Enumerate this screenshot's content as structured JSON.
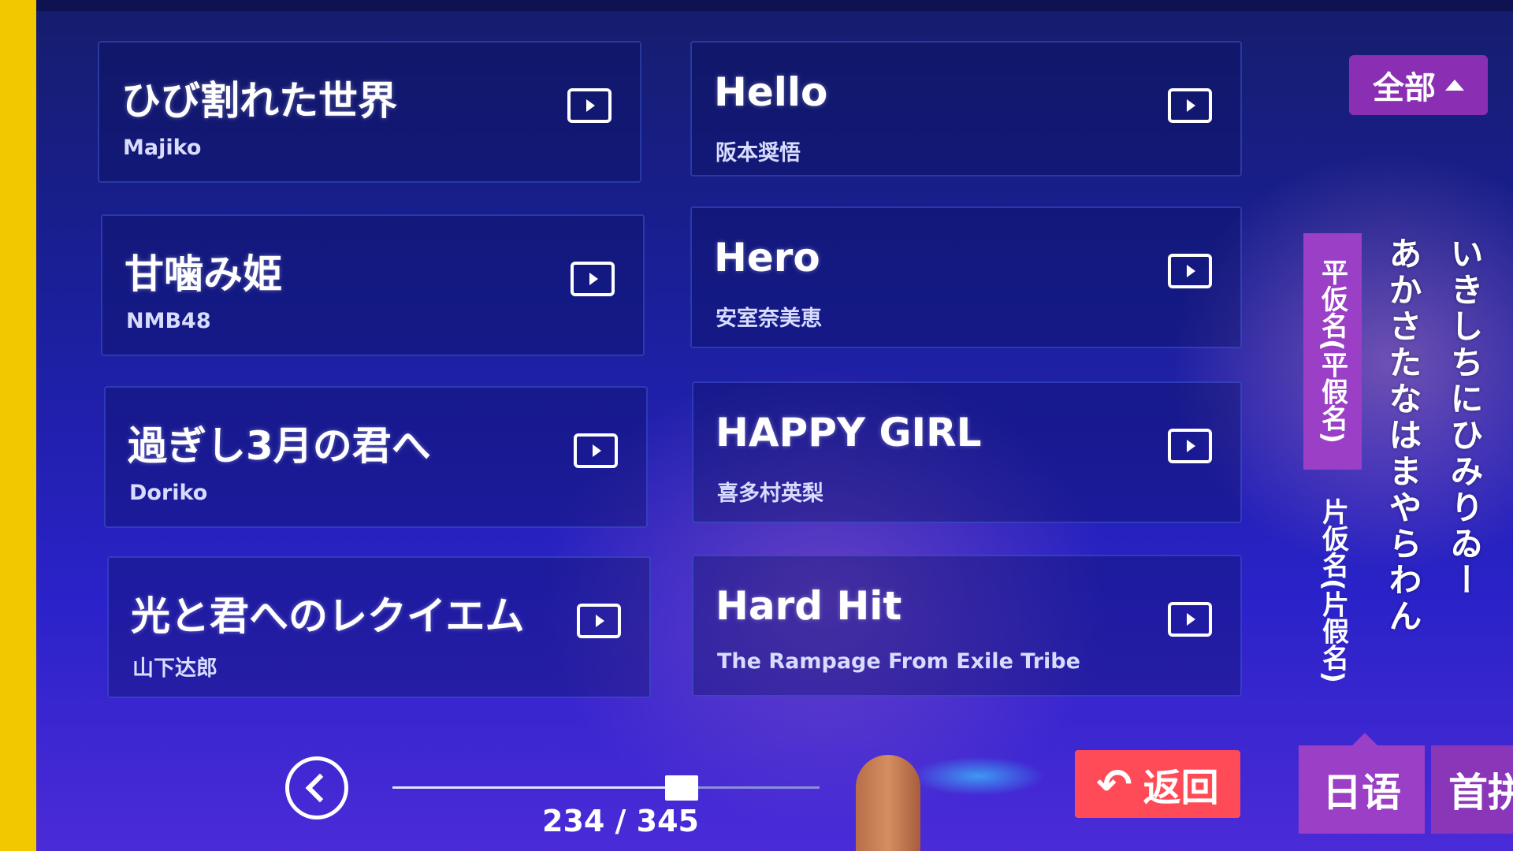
{
  "songs": [
    {
      "title": "ひび割れた世界",
      "artist": "Majiko"
    },
    {
      "title": "Hello",
      "artist": "阪本奨悟"
    },
    {
      "title": "甘噛み姫",
      "artist": "NMB48"
    },
    {
      "title": "Hero",
      "artist": "安室奈美恵"
    },
    {
      "title": "過ぎし3月の君へ",
      "artist": "Doriko"
    },
    {
      "title": "HAPPY GIRL",
      "artist": "喜多村英梨"
    },
    {
      "title": "光と君へのレクイエム",
      "artist": "山下达郎"
    },
    {
      "title": "Hard Hit",
      "artist": "The Rampage From Exile Tribe"
    }
  ],
  "filter": {
    "all_label": "全部"
  },
  "kana_index": {
    "hiragana_label": "平仮名(平假名)",
    "katakana_label": "片仮名(片假名)",
    "col1": "あかさたなはまやらわん",
    "col2": "いきしちにひみりゐー"
  },
  "pager": {
    "text": "234 / 345",
    "progress": 0.678
  },
  "return_label": "返回",
  "tabs": {
    "japanese": "日语",
    "pinyin": "首拼"
  },
  "colors": {
    "accent_purple": "#9a3fc6",
    "return_red": "#ff4b57",
    "background_blue": "#1a1f9a"
  }
}
